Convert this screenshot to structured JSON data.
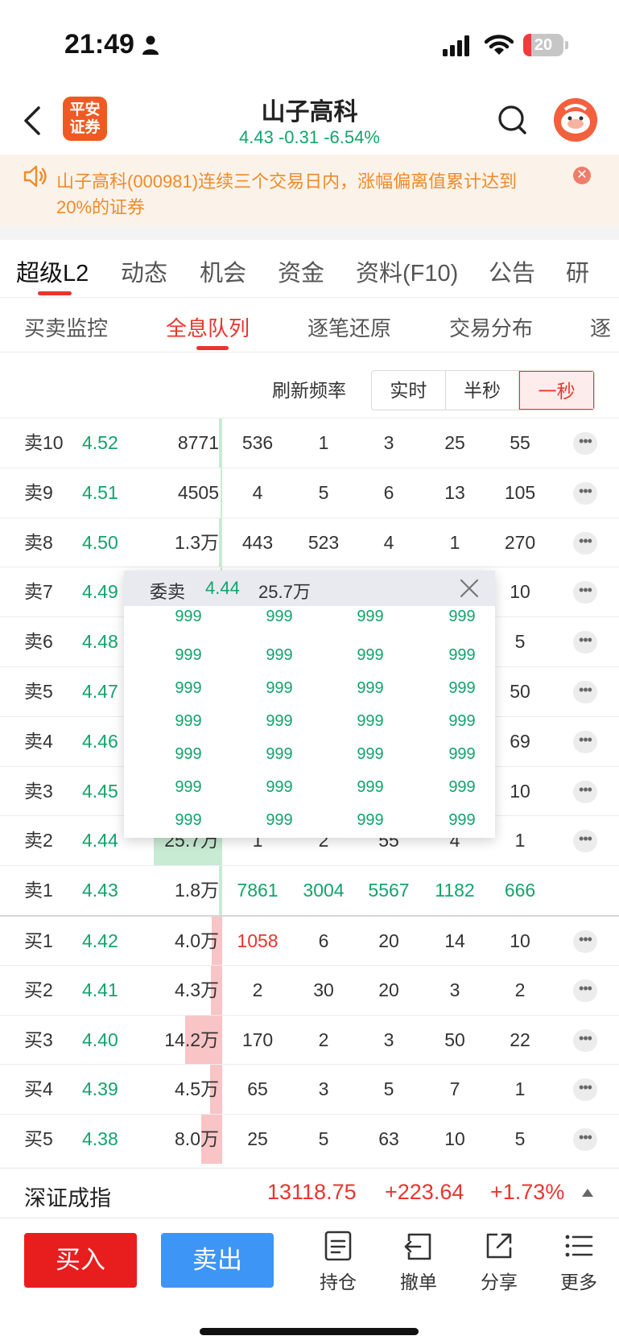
{
  "status_bar": {
    "time": "21:49",
    "battery": "20",
    "battery_level": 0.2
  },
  "header": {
    "broker_logo": "平安证券",
    "stock_name": "山子高科",
    "quote": "4.43 -0.31 -6.54%"
  },
  "notice": {
    "text": "山子高科(000981)连续三个交易日内，涨幅偏离值累计达到20%的证券"
  },
  "main_tabs": [
    "超级L2",
    "动态",
    "机会",
    "资金",
    "资料(F10)",
    "公告",
    "研"
  ],
  "sub_tabs": [
    "买卖监控",
    "全息队列",
    "逐笔还原",
    "交易分布",
    "逐"
  ],
  "refresh": {
    "label": "刷新频率",
    "options": [
      "实时",
      "半秒",
      "一秒"
    ],
    "selected": "一秒"
  },
  "order_book": [
    {
      "label": "卖10",
      "price": "4.52",
      "volume": "8771",
      "bar": 0.03,
      "side": "sell",
      "queue": [
        "536",
        "1",
        "3",
        "25",
        "55"
      ]
    },
    {
      "label": "卖9",
      "price": "4.51",
      "volume": "4505",
      "bar": 0.0,
      "side": "sell",
      "queue": [
        "4",
        "5",
        "6",
        "13",
        "105"
      ]
    },
    {
      "label": "卖8",
      "price": "4.50",
      "volume": "1.3万",
      "bar": 0.04,
      "side": "sell",
      "queue": [
        "443",
        "523",
        "4",
        "1",
        "270"
      ]
    },
    {
      "label": "卖7",
      "price": "4.49",
      "volume": "",
      "bar": 0.0,
      "side": "sell",
      "queue": [
        "",
        "",
        "",
        "",
        "10"
      ]
    },
    {
      "label": "卖6",
      "price": "4.48",
      "volume": "",
      "bar": 0.0,
      "side": "sell",
      "queue": [
        "",
        "",
        "",
        "",
        "5"
      ]
    },
    {
      "label": "卖5",
      "price": "4.47",
      "volume": "",
      "bar": 0.0,
      "side": "sell",
      "queue": [
        "",
        "",
        "",
        "",
        "50"
      ]
    },
    {
      "label": "卖4",
      "price": "4.46",
      "volume": "",
      "bar": 0.0,
      "side": "sell",
      "queue": [
        "",
        "",
        "",
        "",
        "69"
      ]
    },
    {
      "label": "卖3",
      "price": "4.45",
      "volume": "",
      "bar": 0.0,
      "side": "sell",
      "queue": [
        "",
        "",
        "",
        "",
        "10"
      ]
    },
    {
      "label": "卖2",
      "price": "4.44",
      "volume": "25.7万",
      "bar": 0.92,
      "side": "sell",
      "queue": [
        "1",
        "2",
        "55",
        "4",
        "1"
      ]
    },
    {
      "label": "卖1",
      "price": "4.43",
      "volume": "1.8万",
      "bar": 0.04,
      "side": "sell",
      "queue": [
        "7861",
        "3004",
        "5567",
        "1182",
        "666"
      ],
      "queue_color": "green",
      "no_more": true
    },
    {
      "label": "买1",
      "price": "4.42",
      "volume": "4.0万",
      "bar": 0.14,
      "side": "buy",
      "queue": [
        "1058",
        "6",
        "20",
        "14",
        "10"
      ],
      "first_red": true
    },
    {
      "label": "买2",
      "price": "4.41",
      "volume": "4.3万",
      "bar": 0.15,
      "side": "buy",
      "queue": [
        "2",
        "30",
        "20",
        "3",
        "2"
      ]
    },
    {
      "label": "买3",
      "price": "4.40",
      "volume": "14.2万",
      "bar": 0.5,
      "side": "buy",
      "queue": [
        "170",
        "2",
        "3",
        "50",
        "22"
      ]
    },
    {
      "label": "买4",
      "price": "4.39",
      "volume": "4.5万",
      "bar": 0.16,
      "side": "buy",
      "queue": [
        "65",
        "3",
        "5",
        "7",
        "1"
      ]
    },
    {
      "label": "买5",
      "price": "4.38",
      "volume": "8.0万",
      "bar": 0.28,
      "side": "buy",
      "queue": [
        "25",
        "5",
        "63",
        "10",
        "5"
      ]
    }
  ],
  "popup": {
    "title": "委卖",
    "price": "4.44",
    "volume": "25.7万",
    "grid": [
      [
        "999",
        "999",
        "999",
        "999"
      ],
      [
        "999",
        "999",
        "999",
        "999"
      ],
      [
        "999",
        "999",
        "999",
        "999"
      ],
      [
        "999",
        "999",
        "999",
        "999"
      ],
      [
        "999",
        "999",
        "999",
        "999"
      ],
      [
        "999",
        "999",
        "999",
        "999"
      ],
      [
        "999",
        "999",
        "999",
        "999"
      ]
    ]
  },
  "index_bar": {
    "name": "深证成指",
    "value": "13118.75",
    "change": "+223.64",
    "percent": "+1.73%"
  },
  "actions": {
    "buy": "买入",
    "sell": "卖出",
    "tools": [
      "持仓",
      "撤单",
      "分享",
      "更多"
    ]
  },
  "colors": {
    "up": "#e8352f",
    "down": "#13a36b",
    "buy_button": "#e81e1e",
    "sell_button": "#3d95f5",
    "notice_text": "#f08a2a"
  }
}
